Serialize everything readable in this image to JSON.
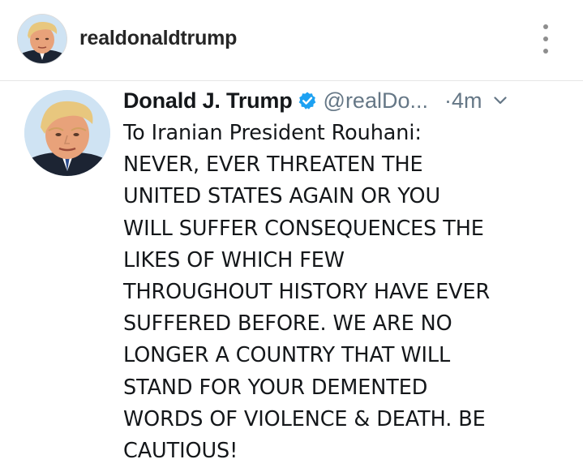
{
  "post": {
    "username": "realdonaldtrump",
    "more_icon": "more-vertical-icon"
  },
  "tweet": {
    "display_name": "Donald J. Trump",
    "verified_icon": "verified-badge-icon",
    "verified_color": "#1da1f2",
    "handle": "@realDo...",
    "timestamp": "·4m",
    "caret_icon": "chevron-down-icon",
    "text": "To Iranian President Rouhani:\nNEVER, EVER THREATEN THE\nUNITED STATES AGAIN OR YOU\nWILL SUFFER CONSEQUENCES THE\nLIKES OF WHICH FEW\nTHROUGHOUT HISTORY HAVE EVER\nSUFFERED BEFORE. WE ARE NO\nLONGER A COUNTRY THAT WILL\nSTAND FOR YOUR DEMENTED\nWORDS OF VIOLENCE & DEATH. BE\nCAUTIOUS!"
  },
  "colors": {
    "text_primary": "#14171a",
    "text_secondary": "#657786",
    "divider": "#e6e6e6"
  }
}
